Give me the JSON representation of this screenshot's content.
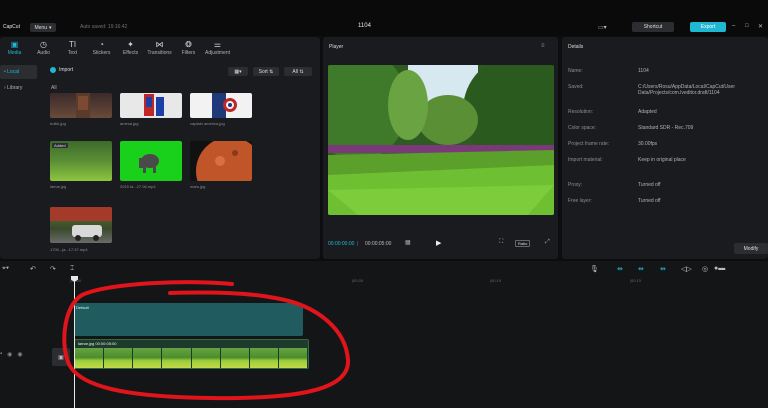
{
  "app": {
    "brand": "CapCut",
    "menu_label": "Menu",
    "autosave": "Auto saved: 19:16:42",
    "project_title": "1104",
    "shortcut_label": "Shortcut",
    "export_label": "Export"
  },
  "media": {
    "tabs": [
      {
        "label": "Media",
        "icon": "media-icon"
      },
      {
        "label": "Audio",
        "icon": "audio-icon"
      },
      {
        "label": "Text",
        "icon": "text-icon"
      },
      {
        "label": "Stickers",
        "icon": "stickers-icon"
      },
      {
        "label": "Effects",
        "icon": "effects-icon"
      },
      {
        "label": "Transitions",
        "icon": "transitions-icon"
      },
      {
        "label": "Filters",
        "icon": "filters-icon"
      },
      {
        "label": "Adjustment",
        "icon": "adjustment-icon"
      }
    ],
    "side_nav": [
      "• Local",
      "› Library"
    ],
    "import_label": "Import",
    "sort_label": "Sort",
    "all_filter_label": "All",
    "section_label": "All",
    "thumbnails": [
      {
        "caption": "hulkk.jpg",
        "added": false
      },
      {
        "caption": "ameca.jpg",
        "added": false
      },
      {
        "caption": "captain america.jpg",
        "added": false
      },
      {
        "caption": "lamar.jpg",
        "added": true
      },
      {
        "caption": "2015 fa...27.06.mp4",
        "added": false
      },
      {
        "caption": "mars.jpg",
        "added": false
      },
      {
        "caption": "1700...ja...17:37.mp4",
        "added": false
      }
    ],
    "added_label": "Added"
  },
  "player": {
    "title": "Player",
    "current_time": "00:00:00:00",
    "duration": "00:00:05:00",
    "ratio_label": "Ratio"
  },
  "details": {
    "title": "Details",
    "rows": [
      {
        "label": "Name:",
        "value": "1104"
      },
      {
        "label": "Saved:",
        "value": "C:/Users/Rosu/AppData/Local/CapCut/User Data/Projects/com.lveditor.draft/1104"
      },
      {
        "label": "Resolution:",
        "value": "Adapted"
      },
      {
        "label": "Color space:",
        "value": "Standard SDR - Rec.709"
      },
      {
        "label": "Project frame rate:",
        "value": "30.00fps"
      },
      {
        "label": "Import material:",
        "value": "Keep in original place"
      },
      {
        "label": "Proxy:",
        "value": "Turned off"
      },
      {
        "label": "Free layer:",
        "value": "Turned off"
      }
    ],
    "modify_label": "Modify"
  },
  "timeline": {
    "ticks": [
      "|00:00",
      "|00:05",
      "|00:10",
      "|00:15"
    ],
    "text_clip_label": "Default",
    "video_clip_label": "lamar.jpg  00:00:05:00"
  },
  "colors": {
    "accent": "#1fb8d3",
    "annotation": "#e0141b",
    "text_clip": "#1f5b5f",
    "video_clip": "#1d3b2a"
  }
}
